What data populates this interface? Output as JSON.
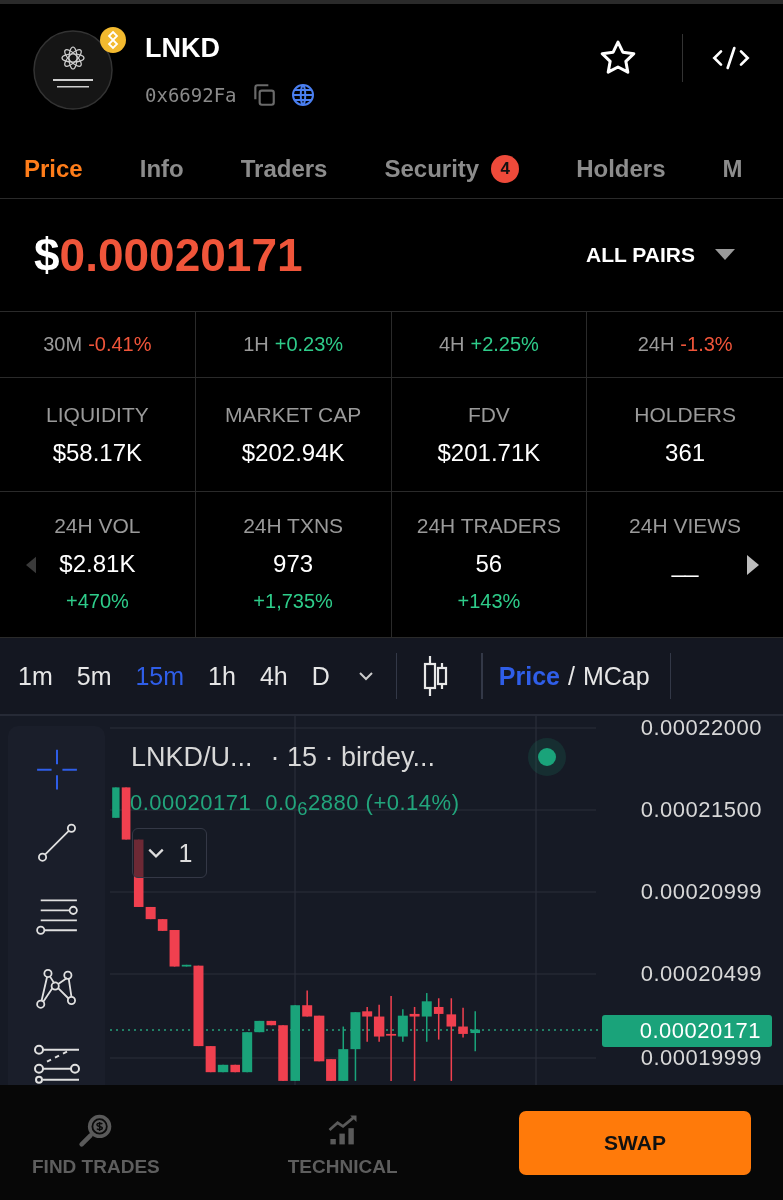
{
  "token": {
    "name": "LNKD",
    "address": "0x6692Fa"
  },
  "tabs": [
    {
      "label": "Price",
      "selected": true
    },
    {
      "label": "Info",
      "selected": false
    },
    {
      "label": "Traders",
      "selected": false
    },
    {
      "label": "Security",
      "selected": false,
      "badge": "4"
    },
    {
      "label": "Holders",
      "selected": false
    },
    {
      "label": "M",
      "selected": false
    }
  ],
  "price": {
    "currency": "$",
    "value": "0.00020171"
  },
  "pair_selector": {
    "label": "ALL PAIRS"
  },
  "changes": [
    {
      "period": "30M",
      "value": "-0.41%",
      "color": "#f0553a"
    },
    {
      "period": "1H",
      "value": "+0.23%",
      "color": "#2ecc8a"
    },
    {
      "period": "4H",
      "value": "+2.25%",
      "color": "#2ecc8a"
    },
    {
      "period": "24H",
      "value": "-1.3%",
      "color": "#f0553a"
    }
  ],
  "stats": [
    {
      "label": "LIQUIDITY",
      "value": "$58.17K"
    },
    {
      "label": "MARKET CAP",
      "value": "$202.94K"
    },
    {
      "label": "FDV",
      "value": "$201.71K"
    },
    {
      "label": "HOLDERS",
      "value": "361"
    }
  ],
  "stats_24h": [
    {
      "label": "24H VOL",
      "value": "$2.81K",
      "change": "+470%",
      "color": "#2ecc8a"
    },
    {
      "label": "24H TXNS",
      "value": "973",
      "change": "+1,735%",
      "color": "#2ecc8a"
    },
    {
      "label": "24H TRADERS",
      "value": "56",
      "change": "+143%",
      "color": "#2ecc8a"
    },
    {
      "label": "24H VIEWS",
      "value": "__"
    }
  ],
  "chart_toolbar": {
    "intervals": [
      {
        "label": "1m",
        "selected": false
      },
      {
        "label": "5m",
        "selected": false
      },
      {
        "label": "15m",
        "selected": true
      },
      {
        "label": "1h",
        "selected": false
      },
      {
        "label": "4h",
        "selected": false
      },
      {
        "label": "D",
        "selected": false
      }
    ],
    "modes": [
      {
        "label": "Price",
        "selected": true
      },
      {
        "label": "MCap",
        "selected": false
      }
    ],
    "separator": "/"
  },
  "chart": {
    "symbol": "LNKD/U...",
    "details": "· 15 · birdey...",
    "live": true,
    "legend_price": "0.00020171",
    "legend_change": "0.0$_{6}$2880 (+0.14%)",
    "collapse_count": "1",
    "y_axis": [
      "0.00022000",
      "0.00021500",
      "0.00020999",
      "0.00020499",
      "0.00019999"
    ],
    "last_price": "0.00020171",
    "tools": [
      {
        "kind": "crosshair",
        "selected": true
      },
      {
        "kind": "trend-line",
        "selected": false
      },
      {
        "kind": "parallel-lines",
        "selected": false
      },
      {
        "kind": "pattern",
        "selected": false
      },
      {
        "kind": "fib",
        "selected": false
      }
    ]
  },
  "bottom_nav": {
    "items": [
      {
        "label": "FIND TRADES",
        "kind": "search"
      },
      {
        "label": "TECHNICAL",
        "kind": "chart"
      }
    ],
    "action": "SWAP"
  }
}
